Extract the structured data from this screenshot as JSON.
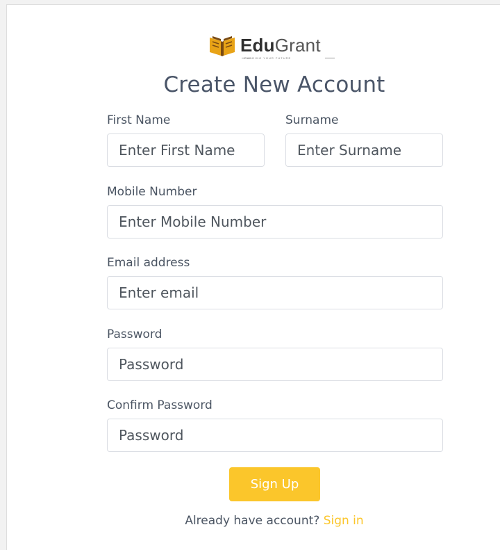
{
  "brand": {
    "name_bold": "Edu",
    "name_light": "Grant",
    "tagline": "FUNDING YOUR FUTURE",
    "colors": {
      "book_primary": "#e8a317",
      "book_dark": "#7a4a12"
    }
  },
  "page": {
    "title": "Create New Account"
  },
  "form": {
    "first_name": {
      "label": "First Name",
      "placeholder": "Enter First Name"
    },
    "surname": {
      "label": "Surname",
      "placeholder": "Enter Surname"
    },
    "mobile": {
      "label": "Mobile Number",
      "placeholder": "Enter Mobile Number"
    },
    "email": {
      "label": "Email address",
      "placeholder": "Enter email"
    },
    "password": {
      "label": "Password",
      "placeholder": "Password"
    },
    "confirm_password": {
      "label": "Confirm Password",
      "placeholder": "Password"
    },
    "submit_label": "Sign Up"
  },
  "footer": {
    "prompt": "Already have account?",
    "link_label": "Sign in"
  },
  "colors": {
    "accent": "#fbc62b",
    "title": "#4a5568"
  }
}
